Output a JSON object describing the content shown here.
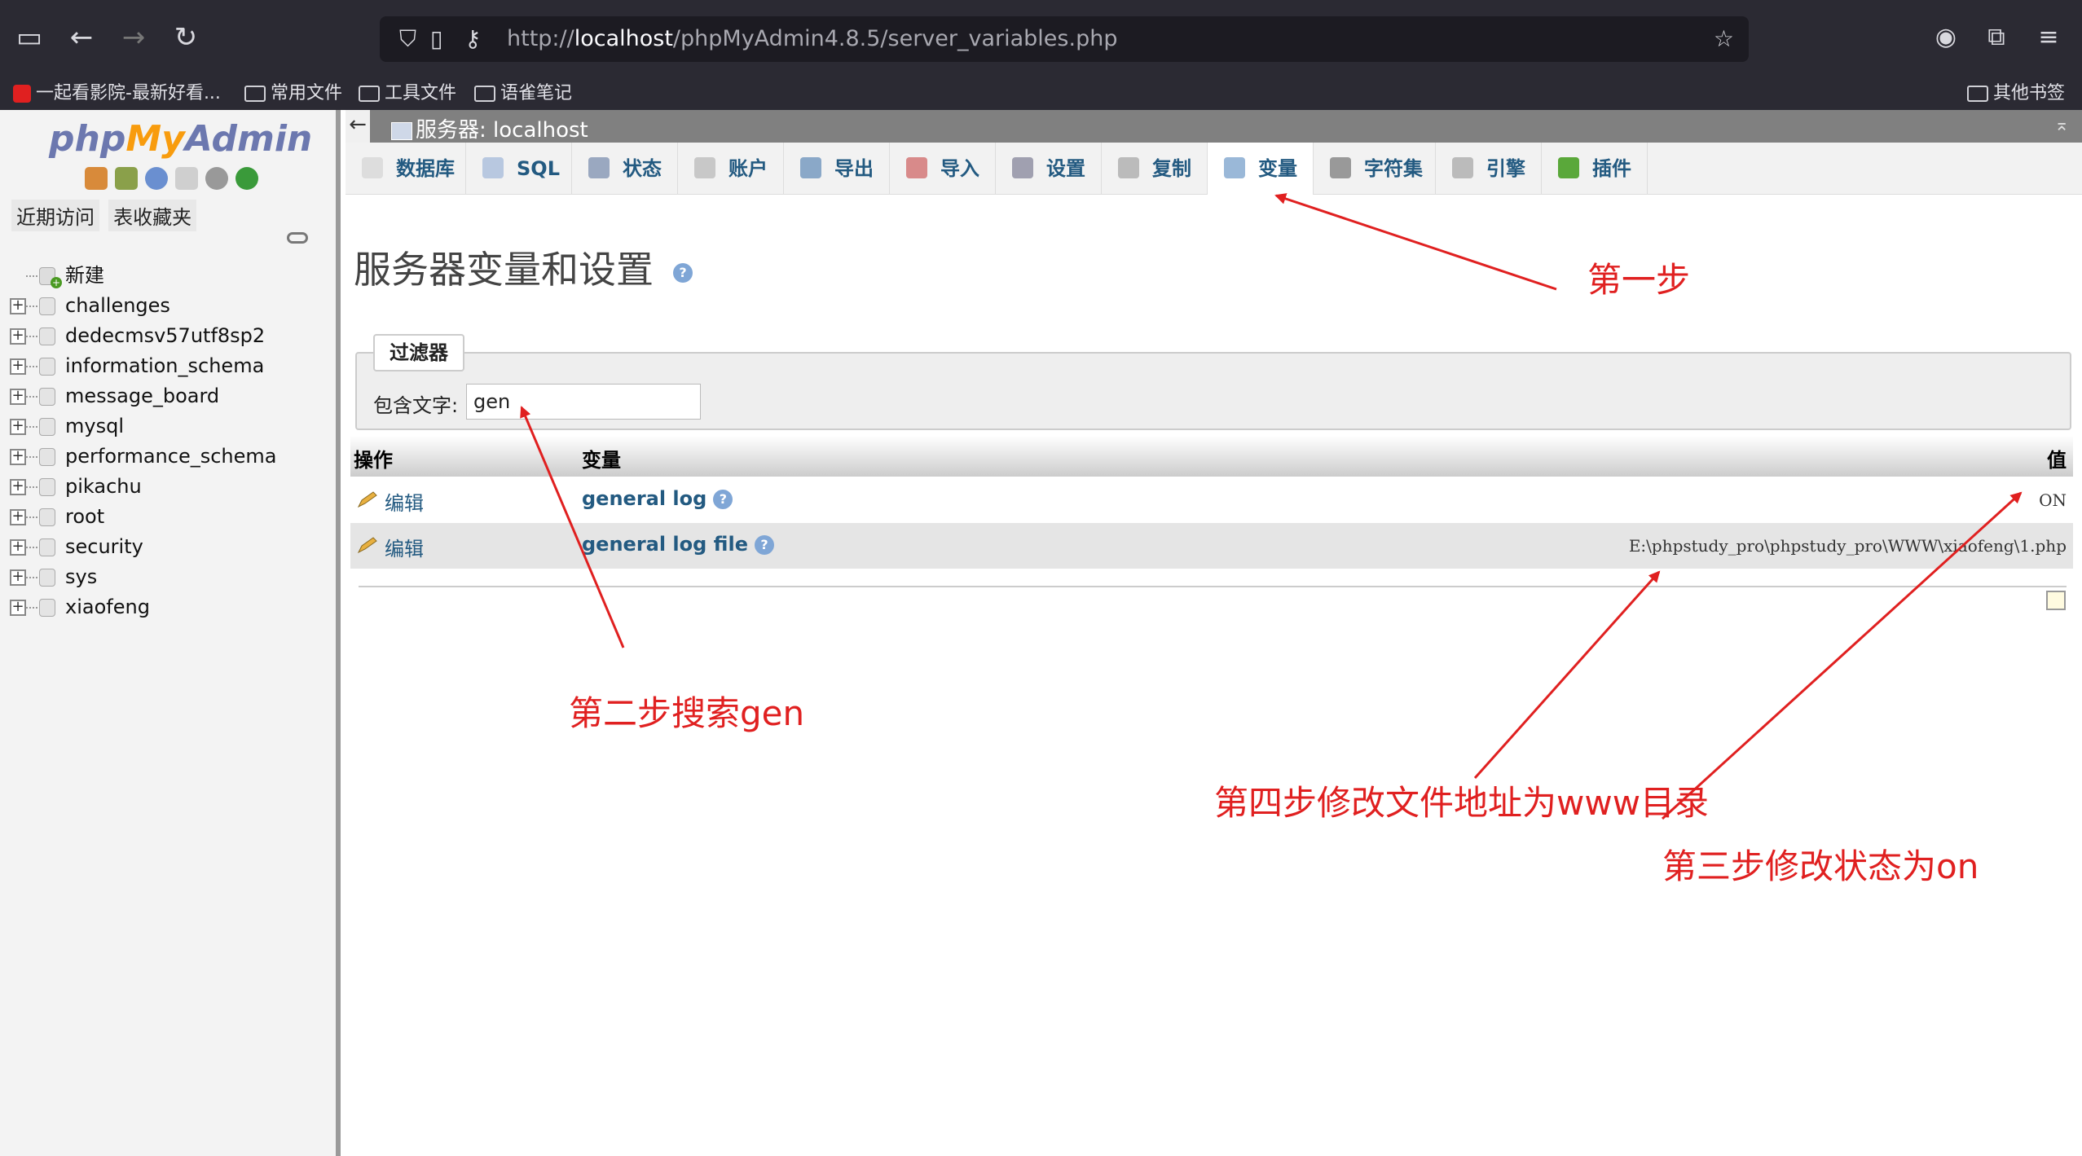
{
  "browser": {
    "url_prefix": "http://",
    "url_host": "localhost",
    "url_path": "/phpMyAdmin4.8.5/server_variables.php",
    "bookmarks": [
      "一起看影院-最新好看...",
      "常用文件",
      "工具文件",
      "语雀笔记"
    ],
    "other_bookmarks": "其他书签"
  },
  "sidebar": {
    "logo": {
      "php": "php",
      "my": "My",
      "admin": "Admin"
    },
    "tabs": [
      "近期访问",
      "表收藏夹"
    ],
    "new_label": "新建",
    "databases": [
      "challenges",
      "dedecmsv57utf8sp2",
      "information_schema",
      "message_board",
      "mysql",
      "performance_schema",
      "pikachu",
      "root",
      "security",
      "sys",
      "xiaofeng"
    ]
  },
  "main": {
    "server_label": "服务器: localhost",
    "tabs": [
      "数据库",
      "SQL",
      "状态",
      "账户",
      "导出",
      "导入",
      "设置",
      "复制",
      "变量",
      "字符集",
      "引擎",
      "插件"
    ],
    "active_tab": "变量",
    "page_title": "服务器变量和设置",
    "filter": {
      "legend": "过滤器",
      "label": "包含文字:",
      "value": "gen"
    },
    "table": {
      "headers": [
        "操作",
        "变量",
        "值"
      ],
      "rows": [
        {
          "action": "编辑",
          "variable": "general log",
          "value": "ON"
        },
        {
          "action": "编辑",
          "variable": "general log file",
          "value": "E:\\phpstudy_pro\\phpstudy_pro\\WWW\\xiaofeng\\1.php"
        }
      ]
    }
  },
  "annotations": {
    "step1": "第一步",
    "step2": "第二步搜索gen",
    "step3": "第三步修改状态为on",
    "step4": "第四步修改文件地址为www目录"
  },
  "colors": {
    "link": "#235a81",
    "annotation": "#e02020",
    "browser_chrome": "#2b2a33"
  }
}
